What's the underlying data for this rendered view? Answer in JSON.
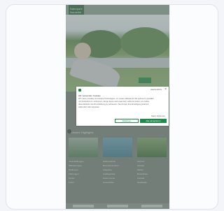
{
  "site": {
    "logo_text": "Naturpark Nordeifel"
  },
  "hero": {
    "button_label": ""
  },
  "section": {
    "title": "Unsere Highlights"
  },
  "columns": [
    [
      "Veranstaltungen",
      "Wanderungen",
      "Radtouren",
      "Führungen",
      "Kinder",
      "Kultur"
    ],
    [
      "Naturerlebnis",
      "Besucherzentren",
      "Angebote",
      "Ausflugsziele",
      "Gastronomie",
      "Unterkünfte"
    ],
    [
      "Service",
      "Anreise",
      "Karten",
      "Broschüren",
      "Kontakt",
      "Newsletter"
    ]
  ],
  "consent": {
    "powered_by": "usercentrics",
    "close_label": "×",
    "title": "Wir verwenden Cookies",
    "text_lines": [
      "Wir nutzen Cookies und andere Technologien, um unsere Website für Sie optimal zu gestalten",
      "und fortlaufend zu verbessern. Einige davon sind essenziell, während andere uns helfen,",
      "diese Website und Ihre Erfahrung zu verbessern. Sie können Ihre Einwilligung jederzeit",
      "widerrufen oder anpassen."
    ],
    "more_link": "Mehr Optionen",
    "decline_label": "Ablehnen",
    "accept_label": "Alle akzeptieren"
  },
  "colors": {
    "brand_green": "#1f8a4a",
    "overlay": "#6e7873"
  }
}
